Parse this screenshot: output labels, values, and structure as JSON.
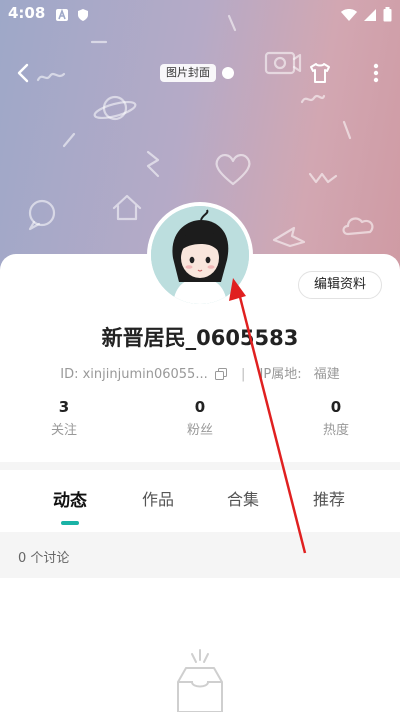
{
  "status_bar": {
    "time": "4:08",
    "icons": [
      "a-app-icon",
      "shield-app-icon",
      "wifi-icon",
      "signal-icon",
      "battery-icon"
    ]
  },
  "nav": {
    "cover_label": "图片封面",
    "back_icon": "back-arrow-icon",
    "theme_icon": "tshirt-icon",
    "more_icon": "more-vertical-icon"
  },
  "profile": {
    "edit_button": "编辑资料",
    "username": "新晋居民_0605583",
    "id_text": "ID: xinjinjumin06055...",
    "ip_label": "IP属地:",
    "ip_value": "福建"
  },
  "stats": [
    {
      "value": "3",
      "label": "关注"
    },
    {
      "value": "0",
      "label": "粉丝"
    },
    {
      "value": "0",
      "label": "热度"
    }
  ],
  "tabs": [
    {
      "label": "动态",
      "active": true
    },
    {
      "label": "作品",
      "active": false
    },
    {
      "label": "合集",
      "active": false
    },
    {
      "label": "推荐",
      "active": false
    }
  ],
  "discussion": {
    "count_text": "0 个讨论"
  },
  "colors": {
    "accent": "#1ab3a6",
    "arrow": "#e02020"
  }
}
